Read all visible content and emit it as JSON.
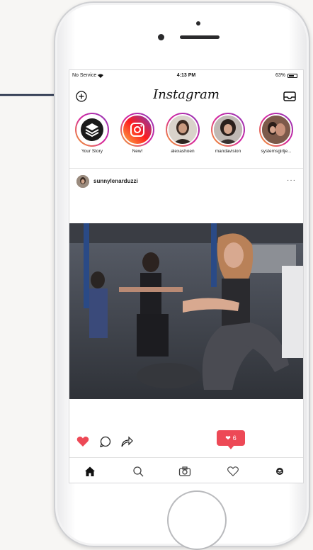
{
  "status_bar": {
    "carrier": "No Service",
    "time": "4:13 PM",
    "battery": "63%"
  },
  "header": {
    "logo": "Instagram",
    "add_story_icon": "add-story-icon",
    "inbox_icon": "inbox-icon"
  },
  "stories": [
    {
      "label": "Your Story"
    },
    {
      "label": "New!"
    },
    {
      "label": "alexashoen"
    },
    {
      "label": "mandavision"
    },
    {
      "label": "systemsgirlje..."
    }
  ],
  "post": {
    "username": "sunnylenarduzzi",
    "more": "···"
  },
  "activity": {
    "likes_count": "6"
  },
  "tabs": [
    "home",
    "search",
    "camera",
    "activity",
    "profile"
  ],
  "colors": {
    "accent": "#ed4956",
    "text": "#111111"
  }
}
